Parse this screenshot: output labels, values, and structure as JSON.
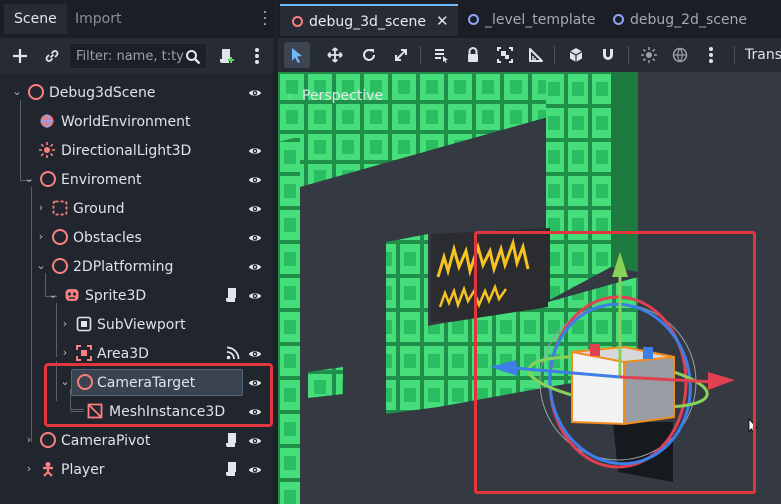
{
  "dock": {
    "tabs": [
      {
        "label": "Scene"
      },
      {
        "label": "Import"
      }
    ],
    "filter_placeholder": "Filter: name, t:type"
  },
  "tree": [
    {
      "label": "Debug3dScene",
      "icon": "node3d-icon",
      "visible_eye": true
    },
    {
      "label": "WorldEnvironment",
      "icon": "world-environment-icon",
      "visible_eye": false
    },
    {
      "label": "DirectionalLight3D",
      "icon": "directional-light-icon",
      "visible_eye": true
    },
    {
      "label": "Enviroment",
      "icon": "node3d-icon",
      "visible_eye": true
    },
    {
      "label": "Ground",
      "icon": "gridmap-icon",
      "visible_eye": true
    },
    {
      "label": "Obstacles",
      "icon": "node3d-icon",
      "visible_eye": true
    },
    {
      "label": "2DPlatforming",
      "icon": "node3d-icon",
      "visible_eye": true
    },
    {
      "label": "Sprite3D",
      "icon": "sprite3d-icon",
      "visible_eye": true,
      "script": true
    },
    {
      "label": "SubViewport",
      "icon": "subviewport-icon",
      "visible_eye": false
    },
    {
      "label": "Area3D",
      "icon": "area3d-icon",
      "visible_eye": true,
      "signals": true
    },
    {
      "label": "CameraTarget",
      "icon": "node3d-icon",
      "visible_eye": true,
      "selected": true
    },
    {
      "label": "MeshInstance3D",
      "icon": "mesh-instance-icon",
      "visible_eye": true
    },
    {
      "label": "CameraPivot",
      "icon": "node3d-icon",
      "visible_eye": true,
      "script": true
    },
    {
      "label": "Player",
      "icon": "character-body-icon",
      "visible_eye": true,
      "script": true
    }
  ],
  "editor": {
    "tabs": [
      {
        "label": "debug_3d_scene",
        "active": true
      },
      {
        "label": "_level_template",
        "active": false
      },
      {
        "label": "debug_2d_scene",
        "active": false
      }
    ],
    "transform_label": "Trans",
    "viewport_label": "Perspective"
  },
  "colors": {
    "accent": "#70bafa",
    "node3d": "#fc7f7f",
    "highlight": "#e1363d",
    "platform_green": "#45de7b"
  }
}
